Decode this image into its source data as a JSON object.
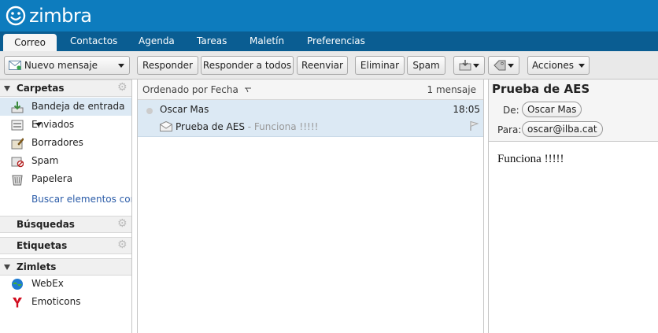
{
  "app": {
    "logo_text": "zimbra"
  },
  "tabs": [
    {
      "label": "Correo",
      "active": true
    },
    {
      "label": "Contactos"
    },
    {
      "label": "Agenda"
    },
    {
      "label": "Tareas"
    },
    {
      "label": "Maletín"
    },
    {
      "label": "Preferencias"
    }
  ],
  "toolbar": {
    "new_message": "Nuevo mensaje",
    "reply": "Responder",
    "reply_all": "Responder a todos",
    "forward": "Reenviar",
    "delete": "Eliminar",
    "spam": "Spam",
    "actions": "Acciones"
  },
  "sidebar": {
    "folders_header": "Carpetas",
    "folders": [
      {
        "label": "Bandeja de entrada",
        "icon": "inbox-icon",
        "selected": true
      },
      {
        "label": "Enviados",
        "icon": "sent-icon"
      },
      {
        "label": "Borradores",
        "icon": "drafts-icon"
      },
      {
        "label": "Spam",
        "icon": "spam-icon"
      },
      {
        "label": "Papelera",
        "icon": "trash-icon"
      }
    ],
    "search_link": "Buscar elementos compartidos",
    "searches_header": "Búsquedas",
    "tags_header": "Etiquetas",
    "zimlets_header": "Zimlets",
    "zimlets": [
      {
        "label": "WebEx",
        "icon": "webex-icon"
      },
      {
        "label": "Emoticons",
        "icon": "yahoo-emoticons-icon"
      }
    ]
  },
  "list": {
    "sort_label": "Ordenado por Fecha",
    "count_label": "1 mensaje",
    "messages": [
      {
        "from": "Oscar Mas",
        "time": "18:05",
        "subject": "Prueba de AES",
        "fragment": " - Funciona !!!!!"
      }
    ]
  },
  "reading": {
    "subject": "Prueba de AES",
    "from_label": "De:",
    "from": "Oscar Mas",
    "to_label": "Para:",
    "to": "oscar@ilba.cat",
    "body": "Funciona !!!!!"
  },
  "colors": {
    "header_bg": "#0d7cbe",
    "tabbar_bg": "#0a5d92",
    "selected_row": "#dce9f4",
    "link": "#2b5ca8"
  }
}
